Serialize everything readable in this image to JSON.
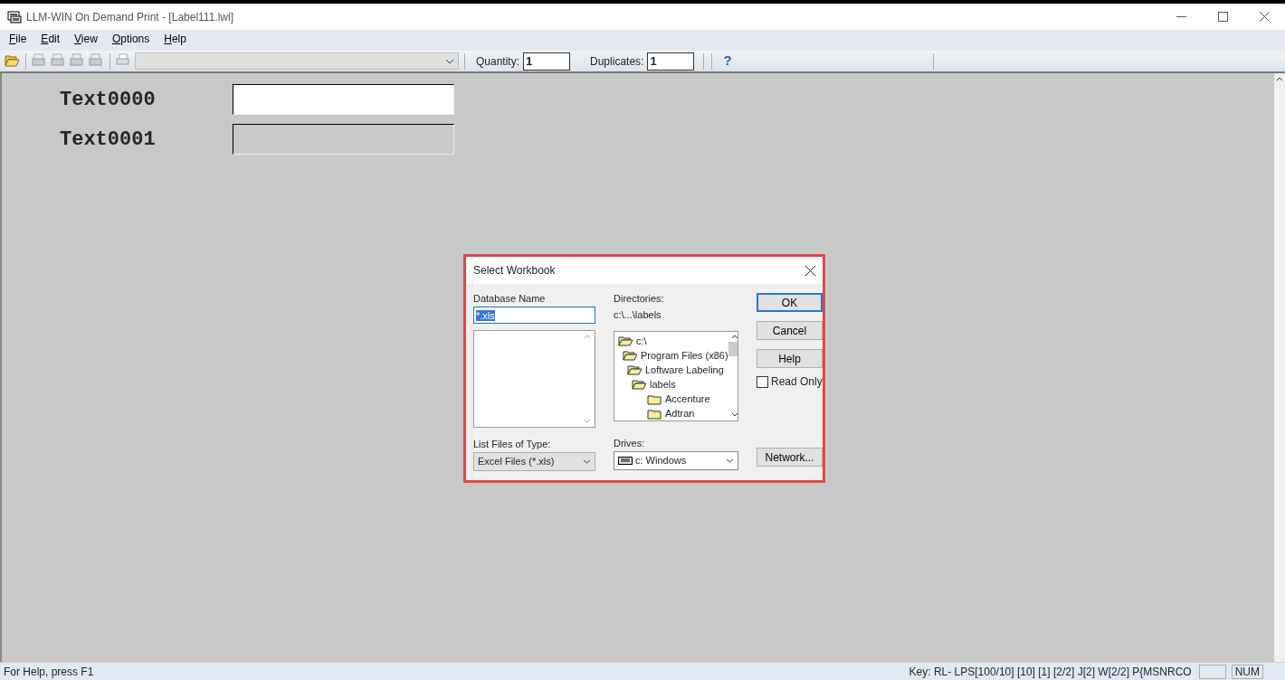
{
  "window": {
    "title": "LLM-WIN On Demand Print - [Label111.lwl]"
  },
  "menu": [
    {
      "label": "File"
    },
    {
      "label": "Edit"
    },
    {
      "label": "View"
    },
    {
      "label": "Options"
    },
    {
      "label": "Help"
    }
  ],
  "toolbar": {
    "quantity_label": "Quantity:",
    "quantity": "1",
    "duplicates_label": "Duplicates:",
    "duplicates": "1",
    "help": "?"
  },
  "fields": [
    {
      "label": "Text0000",
      "disabled": false
    },
    {
      "label": "Text0001",
      "disabled": true
    }
  ],
  "dialog": {
    "title": "Select Workbook",
    "database_name_label": "Database Name",
    "database_name": "*.xls",
    "file_type_label": "List Files of Type:",
    "file_type": "Excel Files (*.xls)",
    "directories_label": "Directories:",
    "path": "c:\\...\\labels",
    "tree": [
      {
        "label": "c:\\",
        "expanded": true,
        "children": [
          {
            "label": "Program Files (x86)",
            "expanded": true,
            "children": [
              {
                "label": "Loftware Labeling",
                "expanded": true,
                "children": [
                  {
                    "label": "labels",
                    "expanded": true,
                    "children": [
                      {
                        "label": "Accenture",
                        "expanded": false
                      },
                      {
                        "label": "Adtran",
                        "expanded": false
                      }
                    ]
                  }
                ]
              }
            ]
          }
        ]
      }
    ],
    "drives_label": "Drives:",
    "drive": "c: Windows",
    "buttons": [
      {
        "label": "OK",
        "default": true
      },
      {
        "label": "Cancel",
        "default": false
      },
      {
        "label": "Help",
        "default": false
      }
    ],
    "read_only": {
      "label": "Read Only",
      "checked": false
    },
    "network_button": "Network..."
  },
  "status_bar": {
    "help": "For Help, press F1",
    "key": "Key: RL- LPS[100/10] [10] [1] [2/2] J[2] W[2/2]  P{MSNRCO",
    "indicator": "NUM"
  }
}
